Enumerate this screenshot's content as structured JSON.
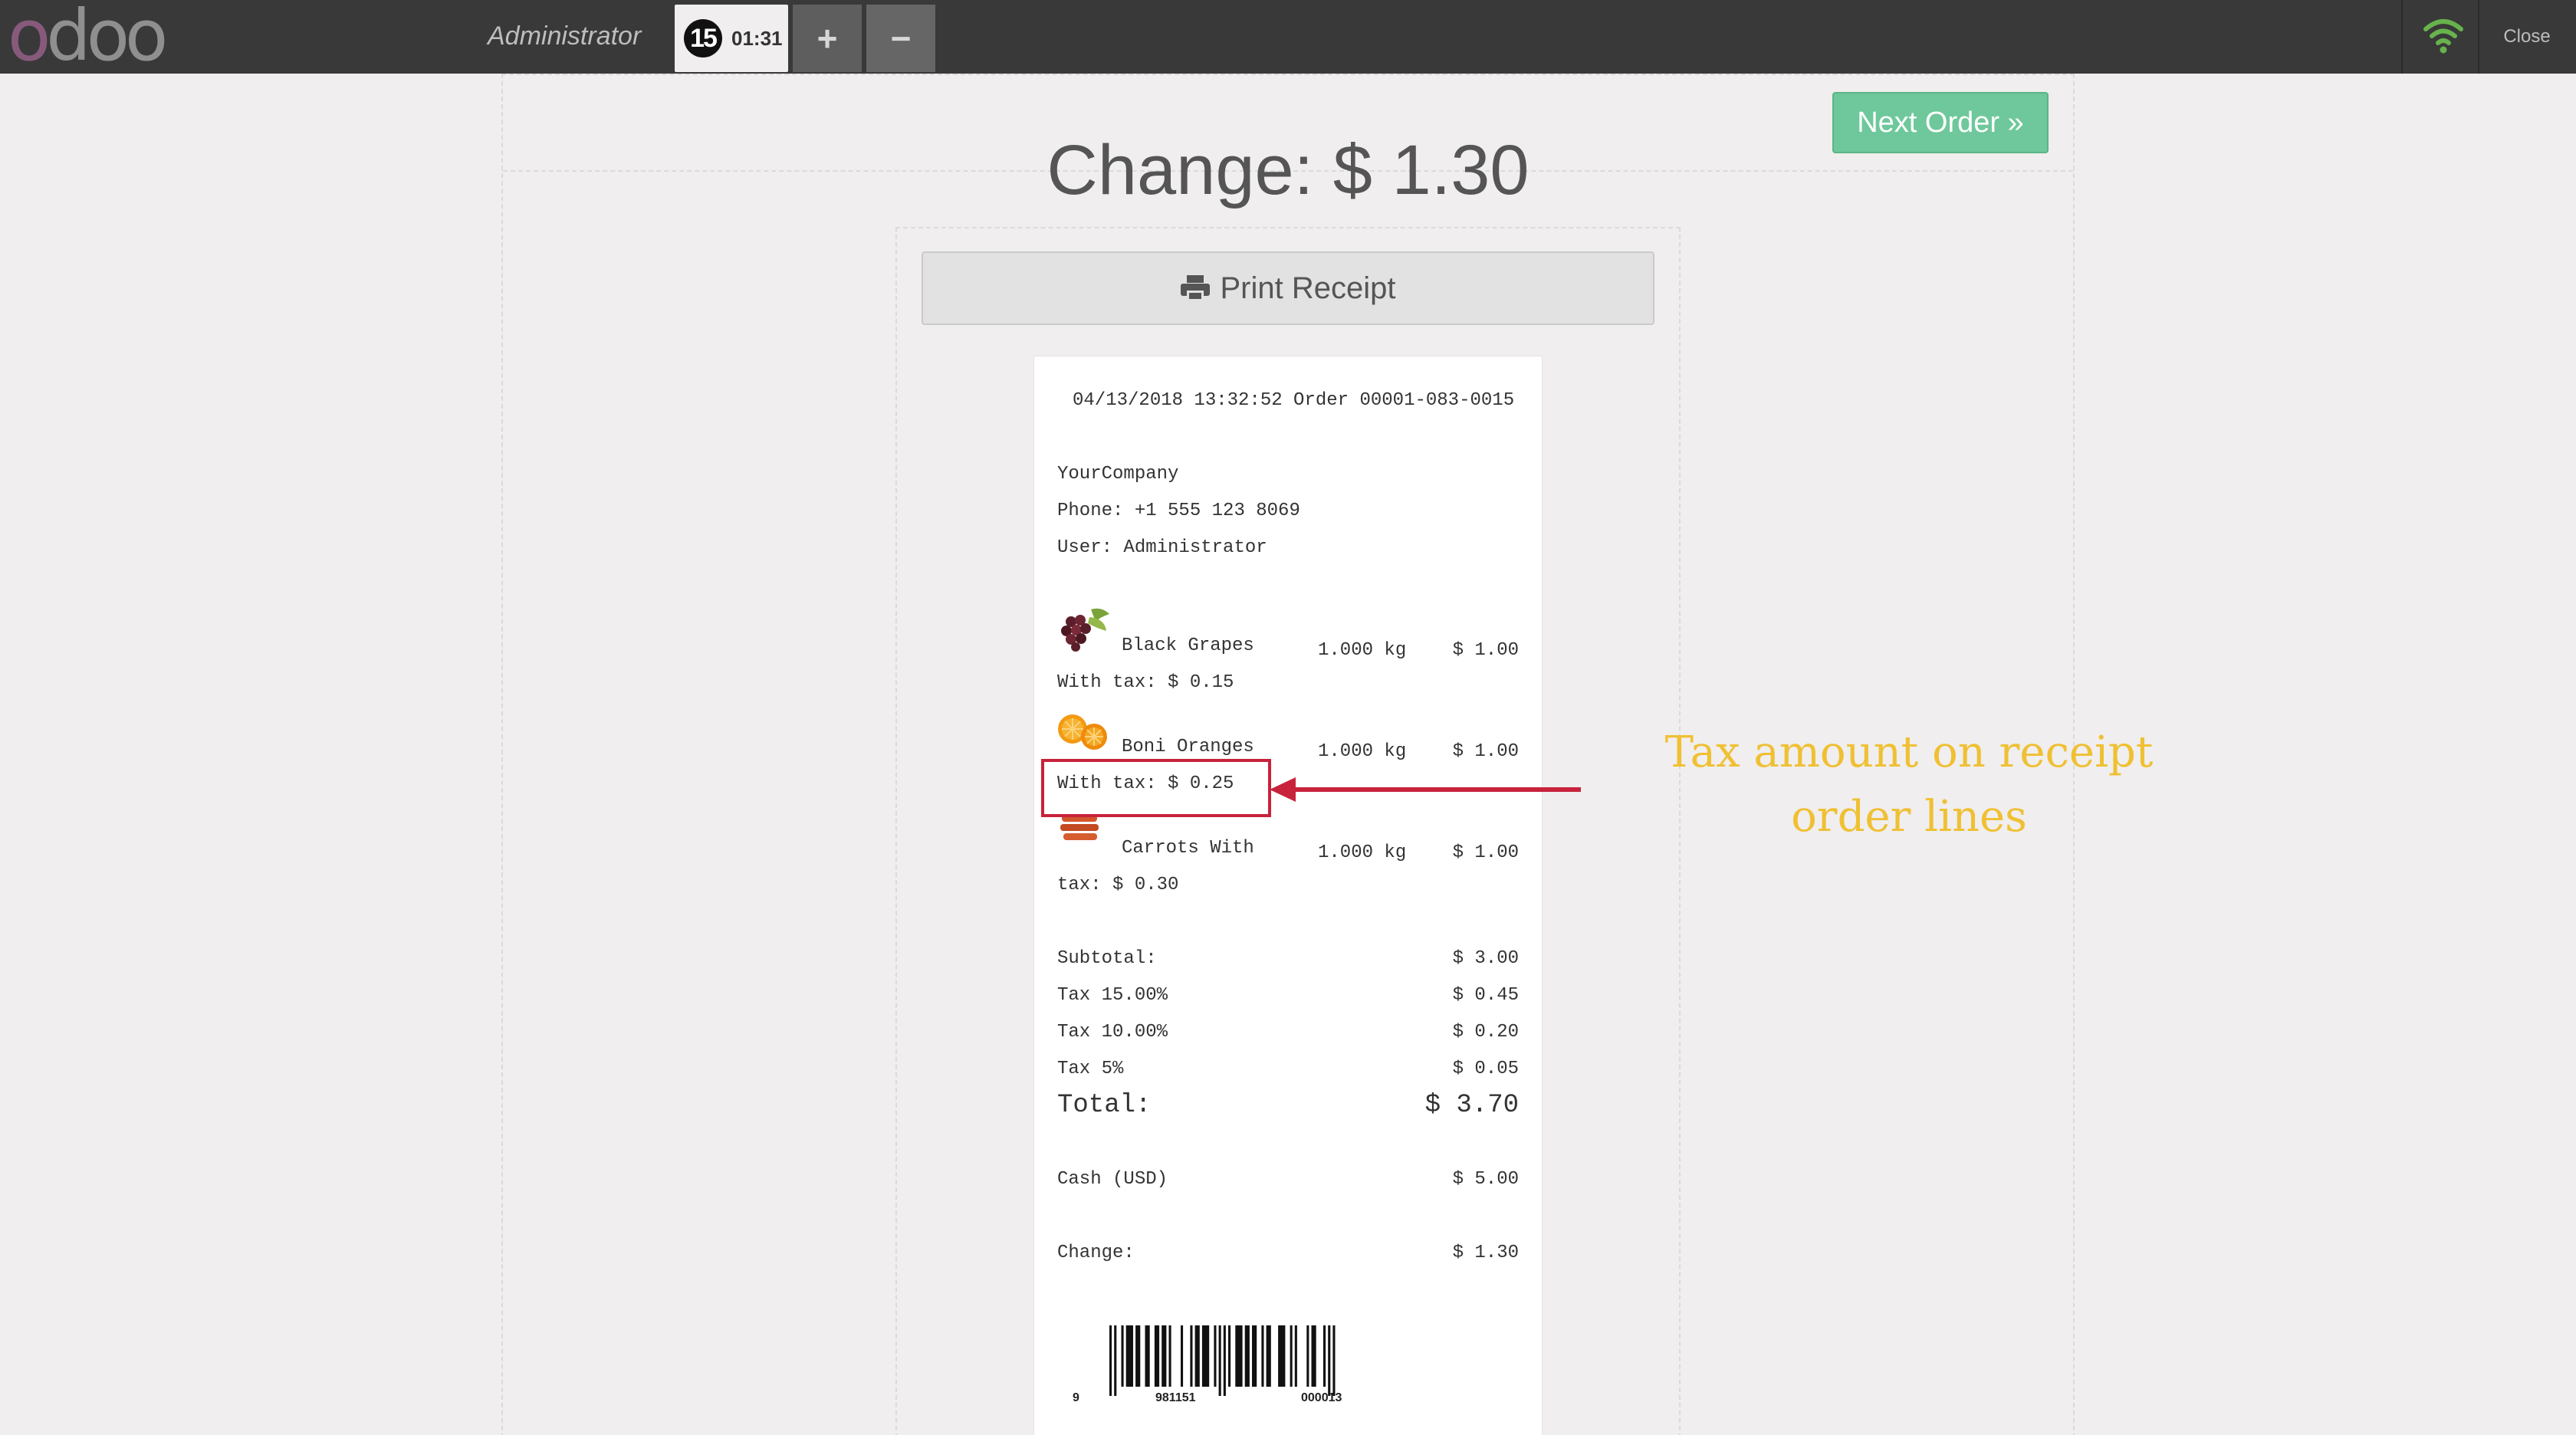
{
  "topbar": {
    "logo_letters": [
      "o",
      "d",
      "o",
      "o"
    ],
    "cashier": "Administrator",
    "order_sequence": "15",
    "order_time": "01:31",
    "add_label": "+",
    "remove_label": "−",
    "close_label": "Close",
    "wifi_color": "#67b24d"
  },
  "screen": {
    "next_order_label": "Next Order »",
    "change_title": "Change: $ 1.30",
    "print_receipt_label": "Print Receipt"
  },
  "receipt": {
    "header": "04/13/2018 13:32:52 Order 00001-083-0015",
    "company": "YourCompany",
    "phone": "Phone: +1 555 123 8069",
    "user": "User: Administrator",
    "lines": [
      {
        "name": "Black Grapes",
        "qty": "1.000 kg",
        "price": "$ 1.00",
        "tax": "With tax: $ 0.15",
        "image": "grapes-image"
      },
      {
        "name": "Boni Oranges",
        "qty": "1.000 kg",
        "price": "$ 1.00",
        "tax": "With tax: $ 0.25",
        "image": "oranges-image"
      },
      {
        "name": "Carrots With",
        "qty": "1.000 kg",
        "price": "$ 1.00",
        "tax": "tax: $ 0.30",
        "image": "carrots-image"
      }
    ],
    "subtotal_label": "Subtotal:",
    "subtotal_value": "$ 3.00",
    "taxes": [
      {
        "label": "Tax 15.00%",
        "value": "$ 0.45"
      },
      {
        "label": "Tax 10.00%",
        "value": "$ 0.20"
      },
      {
        "label": "Tax 5%",
        "value": "$ 0.05"
      }
    ],
    "total_label": "Total:",
    "total_value": "$ 3.70",
    "payment_label": "Cash (USD)",
    "payment_value": "$ 5.00",
    "change_label": "Change:",
    "change_value": "$ 1.30",
    "barcode_digits": [
      "9",
      "981151",
      "000013"
    ]
  },
  "annotation": {
    "line1": "Tax amount on receipt",
    "line2": "order lines",
    "color": "#f0c033",
    "highlight_color": "#c8223c"
  }
}
